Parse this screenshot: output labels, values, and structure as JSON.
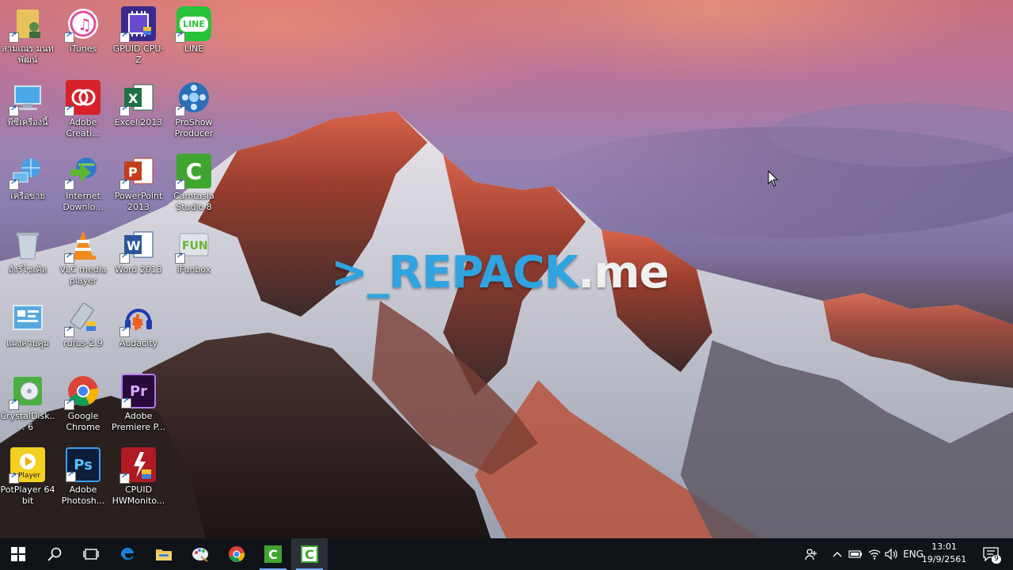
{
  "watermark": {
    "prompt": ">_",
    "brand": "REPACK",
    "suffix": ".me"
  },
  "desktop_icons": [
    {
      "label": "สามเณร มนท พัฒน์",
      "icon": "user-folder-icon"
    },
    {
      "label": "iTunes",
      "icon": "itunes-icon"
    },
    {
      "label": "GPUID CPU-Z",
      "icon": "cpuz-icon"
    },
    {
      "label": "LINE",
      "icon": "line-icon"
    },
    {
      "label": "พีซีเครื่องนี้",
      "icon": "computer-icon"
    },
    {
      "label": "Adobe Creati...",
      "icon": "adobe-cc-icon"
    },
    {
      "label": "Excel 2013",
      "icon": "excel-icon"
    },
    {
      "label": "ProShow Producer",
      "icon": "proshow-icon"
    },
    {
      "label": "เครือข่าย",
      "icon": "network-icon"
    },
    {
      "label": "Internet Downlo...",
      "icon": "idm-icon"
    },
    {
      "label": "PowerPoint 2013",
      "icon": "powerpoint-icon"
    },
    {
      "label": "Camtasia Studio 8",
      "icon": "camtasia-icon"
    },
    {
      "label": "ถังรีไซเคิล",
      "icon": "recycle-bin-icon"
    },
    {
      "label": "VLC media player",
      "icon": "vlc-icon"
    },
    {
      "label": "Word 2013",
      "icon": "word-icon"
    },
    {
      "label": "iFunbox",
      "icon": "ifunbox-icon"
    },
    {
      "label": "แผงควบคุม",
      "icon": "control-panel-icon"
    },
    {
      "label": "rufus-2.9",
      "icon": "rufus-icon"
    },
    {
      "label": "Audacity",
      "icon": "audacity-icon"
    },
    {
      "label": "CrystalDisk... 6",
      "icon": "crystaldisk-icon"
    },
    {
      "label": "Google Chrome",
      "icon": "chrome-icon"
    },
    {
      "label": "Adobe Premiere P...",
      "icon": "premiere-icon"
    },
    {
      "label": "PotPlayer 64 bit",
      "icon": "potplayer-icon"
    },
    {
      "label": "Adobe Photosh...",
      "icon": "photoshop-icon"
    },
    {
      "label": "CPUID HWMonito...",
      "icon": "hwmonitor-icon"
    }
  ],
  "taskbar": {
    "buttons": [
      "start-icon",
      "search-icon",
      "task-view-icon",
      "edge-icon",
      "file-explorer-icon",
      "paint-icon",
      "chrome-icon",
      "camtasia-icon",
      "camtasia-recorder-icon"
    ],
    "tray": {
      "language": "ENG",
      "time": "13:01",
      "date": "19/9/2561",
      "notification_count": "9"
    }
  }
}
